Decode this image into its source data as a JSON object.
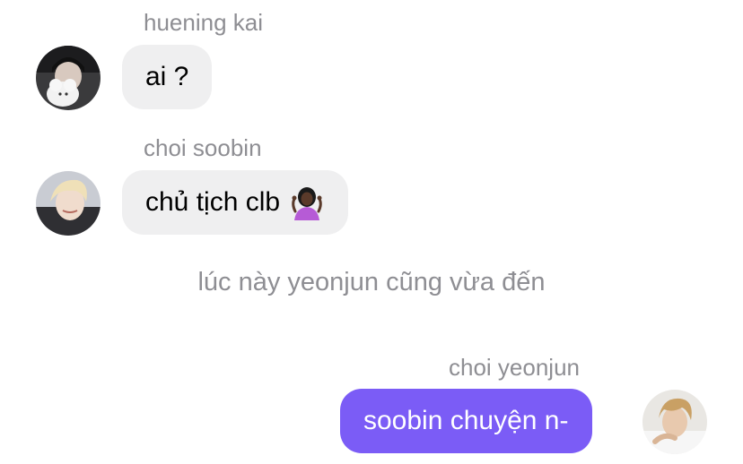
{
  "messages": [
    {
      "sender": "huening kai",
      "text": "ai ?",
      "direction": "incoming",
      "avatar_icon": "avatar-huening-kai"
    },
    {
      "sender": "choi soobin",
      "text": "chủ tịch clb",
      "emoji_icon": "person-shrugging-emoji",
      "direction": "incoming",
      "avatar_icon": "avatar-choi-soobin"
    },
    {
      "sender": "choi yeonjun",
      "text": "soobin chuyện n-",
      "direction": "outgoing",
      "avatar_icon": "avatar-choi-yeonjun"
    }
  ],
  "narration": "lúc này yeonjun cũng vừa đến",
  "colors": {
    "incoming_bubble": "#efeff0",
    "outgoing_bubble": "#7b5cf6",
    "sender_text": "#8e8e93"
  }
}
